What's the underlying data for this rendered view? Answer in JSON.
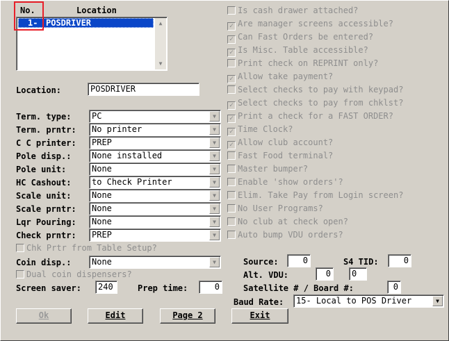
{
  "list": {
    "header_no": "No.",
    "header_location": "Location",
    "rows": [
      {
        "num": "1-",
        "name": "POSDRIVER"
      }
    ]
  },
  "location": {
    "label": "Location:",
    "value": "POSDRIVER"
  },
  "fields": [
    {
      "label": "Term. type:",
      "value": "PC"
    },
    {
      "label": "Term. prntr:",
      "value": "No printer"
    },
    {
      "label": "C C printer:",
      "value": "PREP"
    },
    {
      "label": "Pole disp.:",
      "value": "None installed"
    },
    {
      "label": "Pole unit:",
      "value": "None"
    },
    {
      "label": "HC Cashout:",
      "value": "to Check Printer"
    },
    {
      "label": "Scale unit:",
      "value": "None"
    },
    {
      "label": "Scale prntr:",
      "value": "None"
    },
    {
      "label": "Lqr Pouring:",
      "value": "None"
    },
    {
      "label": "Check prntr:",
      "value": "PREP"
    }
  ],
  "chk_prtr_table": {
    "label": "Chk Prtr from Table Setup?",
    "checked": false
  },
  "coin_disp": {
    "label": "Coin disp.:",
    "value": "None"
  },
  "dual_coin": {
    "label": "Dual coin dispensers?",
    "checked": false
  },
  "screen_saver": {
    "label": "Screen saver:",
    "value": "240"
  },
  "prep_time": {
    "label": "Prep time:",
    "value": "0"
  },
  "options": [
    {
      "label": "Is cash drawer attached?",
      "checked": false
    },
    {
      "label": "Are manager screens accessible?",
      "checked": true
    },
    {
      "label": "Can Fast Orders be entered?",
      "checked": true
    },
    {
      "label": "Is Misc. Table accessible?",
      "checked": true
    },
    {
      "label": "Print check on REPRINT only?",
      "checked": false
    },
    {
      "label": "Allow take payment?",
      "checked": true
    },
    {
      "label": "Select checks to pay with keypad?",
      "checked": false
    },
    {
      "label": "Select checks to pay from chklst?",
      "checked": true
    },
    {
      "label": "Print a check for a FAST ORDER?",
      "checked": true
    },
    {
      "label": "Time Clock?",
      "checked": true
    },
    {
      "label": "Allow club account?",
      "checked": true
    },
    {
      "label": "Fast Food terminal?",
      "checked": false
    },
    {
      "label": "Master bumper?",
      "checked": false
    },
    {
      "label": "Enable 'show orders'?",
      "checked": false
    },
    {
      "label": "Elim. Take Pay from Login screen?",
      "checked": false
    },
    {
      "label": "No User Programs?",
      "checked": false
    },
    {
      "label": "No club at check open?",
      "checked": false
    },
    {
      "label": "Auto bump VDU orders?",
      "checked": false
    }
  ],
  "source": {
    "label": "Source:",
    "value": "0"
  },
  "s4_tid": {
    "label": "S4 TID:",
    "value": "0"
  },
  "alt_vdu": {
    "label": "Alt. VDU:",
    "value1": "0",
    "value2": "0"
  },
  "satellite": {
    "label": "Satellite # / Board #:",
    "value": "0"
  },
  "baud_rate": {
    "label": "Baud Rate:",
    "value": "15- Local to POS Driver"
  },
  "buttons": {
    "ok": "Ok",
    "edit": "Edit",
    "page2": "Page 2",
    "exit": "Exit"
  },
  "icons": {
    "check": "check-icon",
    "dropdown": "chevron-down-icon",
    "scroll_up": "scroll-up-icon",
    "scroll_down": "scroll-down-icon"
  },
  "colors": {
    "selection": "#0a46c8",
    "highlight_box": "#e8202a",
    "background": "#d4d0c8"
  }
}
